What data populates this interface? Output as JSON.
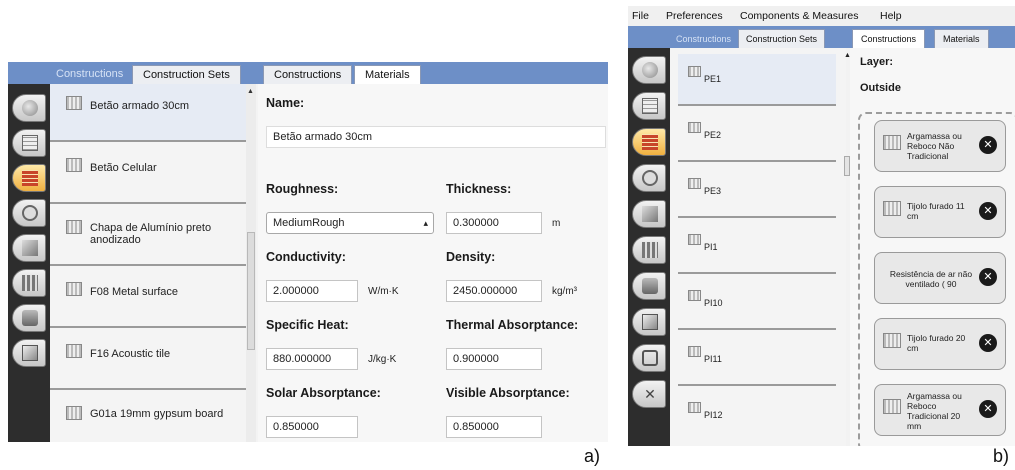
{
  "panel_a": {
    "tabs": [
      "Constructions",
      "Construction Sets",
      "Constructions",
      "Materials"
    ],
    "list_items": [
      "Betão armado 30cm",
      "Betão Celular",
      "Chapa de Alumínio preto anodizado",
      "F08 Metal surface",
      "F16 Acoustic tile",
      "G01a 19mm gypsum board"
    ],
    "name_label": "Name:",
    "name_value": "Betão armado 30cm",
    "roughness_label": "Roughness:",
    "roughness_value": "MediumRough",
    "thickness_label": "Thickness:",
    "thickness_value": "0.300000",
    "thickness_unit": "m",
    "conductivity_label": "Conductivity:",
    "conductivity_value": "2.000000",
    "conductivity_unit": "W/m·K",
    "density_label": "Density:",
    "density_value": "2450.000000",
    "density_unit": "kg/m³",
    "specific_heat_label": "Specific Heat:",
    "specific_heat_value": "880.000000",
    "specific_heat_unit": "J/kg·K",
    "thermal_abs_label": "Thermal Absorptance:",
    "thermal_abs_value": "0.900000",
    "solar_abs_label": "Solar Absorptance:",
    "solar_abs_value": "0.850000",
    "visible_abs_label": "Visible Absorptance:",
    "visible_abs_value": "0.850000",
    "caption": "a)"
  },
  "panel_b": {
    "menu": [
      "File",
      "Preferences",
      "Components & Measures",
      "Help"
    ],
    "tabs": [
      "Constructions",
      "Construction Sets",
      "Constructions",
      "Materials"
    ],
    "list_items": [
      "PE1",
      "PE2",
      "PE3",
      "PI1",
      "PI10",
      "PI11",
      "PI12"
    ],
    "layer_label": "Layer:",
    "outside_label": "Outside",
    "layers": [
      "Argamassa ou Reboco Não Tradicional",
      "Tijolo furado 11 cm",
      "Resistência de ar não ventilado ( 90",
      "Tijolo furado 20 cm",
      "Argamassa ou Reboco Tradicional 20 mm"
    ],
    "caption": "b)"
  },
  "colors": {
    "tab_bar": "#6d8fc7",
    "sidebar": "#2d2d2d",
    "selected_item": "#e6ebf4"
  }
}
